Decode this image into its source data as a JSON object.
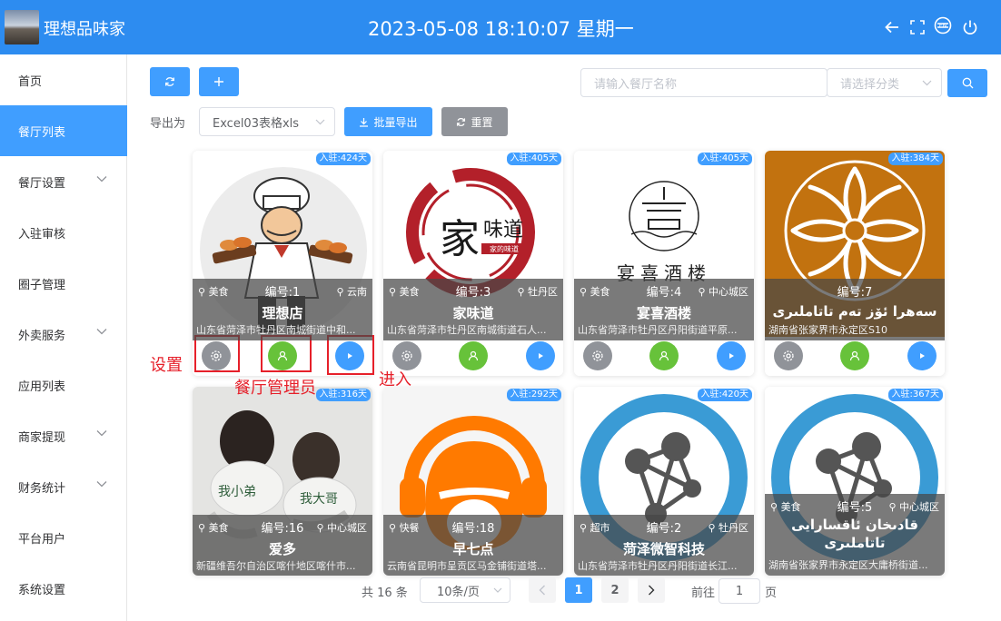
{
  "header": {
    "app_title": "理想品味家",
    "datetime": "2023-05-08 18:10:07 星期一",
    "icons": [
      "back-arrow-icon",
      "fullscreen-icon",
      "language-icon",
      "power-icon"
    ]
  },
  "sidebar": {
    "items": [
      {
        "label": "首页",
        "has_submenu": false
      },
      {
        "label": "餐厅列表",
        "has_submenu": false,
        "active": true
      },
      {
        "label": "餐厅设置",
        "has_submenu": true
      },
      {
        "label": "入驻审核",
        "has_submenu": false
      },
      {
        "label": "圈子管理",
        "has_submenu": false
      },
      {
        "label": "外卖服务",
        "has_submenu": true
      },
      {
        "label": "应用列表",
        "has_submenu": false
      },
      {
        "label": "商家提现",
        "has_submenu": true
      },
      {
        "label": "财务统计",
        "has_submenu": true
      },
      {
        "label": "平台用户",
        "has_submenu": false
      },
      {
        "label": "系统设置",
        "has_submenu": false
      }
    ]
  },
  "toolbar": {
    "search_placeholder": "请输入餐厅名称",
    "category_placeholder": "请选择分类",
    "export_label": "导出为",
    "export_format": "Excel03表格xls",
    "batch_export": "批量导出",
    "reset": "重置"
  },
  "restaurants": [
    {
      "badge": "入驻:424天",
      "category": "美食",
      "number": "编号:1",
      "area": "云南",
      "name": "理想店",
      "address": "山东省菏泽市牡丹区南城街道中和..."
    },
    {
      "badge": "入驻:405天",
      "category": "美食",
      "number": "编号:3",
      "area": "牡丹区",
      "name": "家味道",
      "address": "山东省菏泽市牡丹区南城街道石人..."
    },
    {
      "badge": "入驻:405天",
      "category": "美食",
      "number": "编号:4",
      "area": "中心城区",
      "name": "宴喜酒楼",
      "address": "山东省菏泽市牡丹区丹阳街道平原..."
    },
    {
      "badge": "入驻:384天",
      "category": "",
      "number": "编号:7",
      "area": "",
      "name": "سەھرا ئۆز تەم تاتاملىرى",
      "address": "湖南省张家界市永定区S10"
    },
    {
      "badge": "入驻:316天",
      "category": "美食",
      "number": "编号:16",
      "area": "中心城区",
      "name": "爱多",
      "address": "新疆维吾尔自治区喀什地区喀什市..."
    },
    {
      "badge": "入驻:292天",
      "category": "快餐",
      "number": "编号:18",
      "area": "",
      "name": "早七点",
      "address": "云南省昆明市呈贡区马金铺街道塔..."
    },
    {
      "badge": "入驻:420天",
      "category": "超市",
      "number": "编号:2",
      "area": "牡丹区",
      "name": "菏泽微智科技",
      "address": "山东省菏泽市牡丹区丹阳街道长江..."
    },
    {
      "badge": "入驻:367天",
      "category": "美食",
      "number": "编号:5",
      "area": "中心城区",
      "name": "قادىخان ئاقسارايى تاتاملىرى",
      "address": "湖南省张家界市永定区大庸桥街道..."
    }
  ],
  "annotations": {
    "settings": "设置",
    "admin": "餐厅管理员",
    "enter": "进入"
  },
  "logo_texts": {
    "jiaweidao_main": "家",
    "jiaweidao_side": "味道",
    "jiaweidao_small": "家的味道",
    "yanxi": "宴喜酒楼",
    "photo_shirt_left": "我小弟",
    "photo_shirt_right": "我大哥"
  },
  "pagination": {
    "total": "共 16 条",
    "page_size": "10条/页",
    "pages": [
      "1",
      "2"
    ],
    "current_page": "1",
    "goto_label": "前往",
    "goto_value": "1",
    "page_unit": "页"
  },
  "colors": {
    "primary": "#409eff",
    "header": "#2d8cf0",
    "success": "#67c23a",
    "info": "#909399",
    "annotation": "#e6202a"
  }
}
